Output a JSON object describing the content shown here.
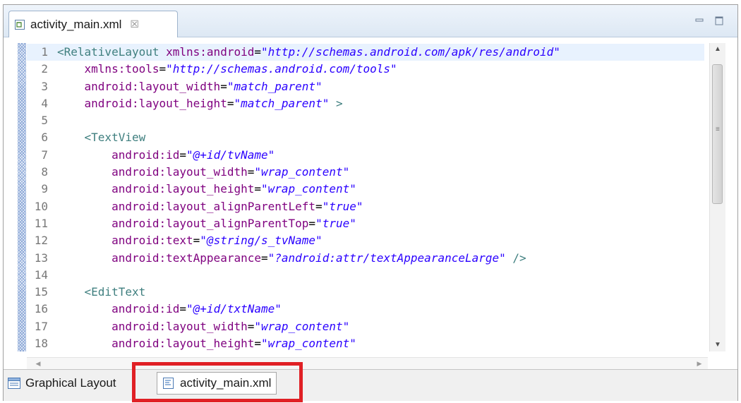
{
  "editor_tab": {
    "label": "activity_main.xml",
    "close_symbol": "☒"
  },
  "code_lines": [
    {
      "num": "1",
      "tokens": [
        {
          "t": "tag",
          "v": "<RelativeLayout "
        },
        {
          "t": "attr",
          "v": "xmlns:android"
        },
        {
          "t": "eq",
          "v": "="
        },
        {
          "t": "val",
          "v": "\"http://schemas.android.com/apk/res/android\""
        }
      ]
    },
    {
      "num": "2",
      "tokens": [
        {
          "t": "attr",
          "v": "    xmlns:tools"
        },
        {
          "t": "eq",
          "v": "="
        },
        {
          "t": "val",
          "v": "\"http://schemas.android.com/tools\""
        }
      ]
    },
    {
      "num": "3",
      "tokens": [
        {
          "t": "attr",
          "v": "    android:layout_width"
        },
        {
          "t": "eq",
          "v": "="
        },
        {
          "t": "val",
          "v": "\"match_parent\""
        }
      ]
    },
    {
      "num": "4",
      "tokens": [
        {
          "t": "attr",
          "v": "    android:layout_height"
        },
        {
          "t": "eq",
          "v": "="
        },
        {
          "t": "val",
          "v": "\"match_parent\""
        },
        {
          "t": "tag",
          "v": " >"
        }
      ]
    },
    {
      "num": "5",
      "tokens": []
    },
    {
      "num": "6",
      "tokens": [
        {
          "t": "tag",
          "v": "    <TextView"
        }
      ]
    },
    {
      "num": "7",
      "tokens": [
        {
          "t": "attr",
          "v": "        android:id"
        },
        {
          "t": "eq",
          "v": "="
        },
        {
          "t": "val",
          "v": "\"@+id/tvName\""
        }
      ]
    },
    {
      "num": "8",
      "tokens": [
        {
          "t": "attr",
          "v": "        android:layout_width"
        },
        {
          "t": "eq",
          "v": "="
        },
        {
          "t": "val",
          "v": "\"wrap_content\""
        }
      ]
    },
    {
      "num": "9",
      "tokens": [
        {
          "t": "attr",
          "v": "        android:layout_height"
        },
        {
          "t": "eq",
          "v": "="
        },
        {
          "t": "val",
          "v": "\"wrap_content\""
        }
      ]
    },
    {
      "num": "10",
      "tokens": [
        {
          "t": "attr",
          "v": "        android:layout_alignParentLeft"
        },
        {
          "t": "eq",
          "v": "="
        },
        {
          "t": "val",
          "v": "\"true\""
        }
      ]
    },
    {
      "num": "11",
      "tokens": [
        {
          "t": "attr",
          "v": "        android:layout_alignParentTop"
        },
        {
          "t": "eq",
          "v": "="
        },
        {
          "t": "val",
          "v": "\"true\""
        }
      ]
    },
    {
      "num": "12",
      "tokens": [
        {
          "t": "attr",
          "v": "        android:text"
        },
        {
          "t": "eq",
          "v": "="
        },
        {
          "t": "val",
          "v": "\"@string/s_tvName\""
        }
      ]
    },
    {
      "num": "13",
      "tokens": [
        {
          "t": "attr",
          "v": "        android:textAppearance"
        },
        {
          "t": "eq",
          "v": "="
        },
        {
          "t": "val",
          "v": "\"?android:attr/textAppearanceLarge\""
        },
        {
          "t": "tag",
          "v": " />"
        }
      ]
    },
    {
      "num": "14",
      "tokens": []
    },
    {
      "num": "15",
      "tokens": [
        {
          "t": "tag",
          "v": "    <EditText"
        }
      ]
    },
    {
      "num": "16",
      "tokens": [
        {
          "t": "attr",
          "v": "        android:id"
        },
        {
          "t": "eq",
          "v": "="
        },
        {
          "t": "val",
          "v": "\"@+id/txtName\""
        }
      ]
    },
    {
      "num": "17",
      "tokens": [
        {
          "t": "attr",
          "v": "        android:layout_width"
        },
        {
          "t": "eq",
          "v": "="
        },
        {
          "t": "val",
          "v": "\"wrap_content\""
        }
      ]
    },
    {
      "num": "18",
      "tokens": [
        {
          "t": "attr",
          "v": "        android:layout_height"
        },
        {
          "t": "eq",
          "v": "="
        },
        {
          "t": "val",
          "v": "\"wrap_content\""
        }
      ]
    }
  ],
  "current_line": "1",
  "bottom_tabs": {
    "graphical": "Graphical Layout",
    "xml": "activity_main.xml"
  },
  "icons": {
    "file": "xml-file-icon",
    "minimize": "minimize-icon",
    "maximize": "maximize-icon",
    "graphical": "graphical-layout-icon",
    "xml_tab": "xml-source-icon"
  },
  "colors": {
    "highlight": "#e02025",
    "tag": "#3f7f7f",
    "attribute": "#7f007f",
    "value": "#2a00ff"
  }
}
